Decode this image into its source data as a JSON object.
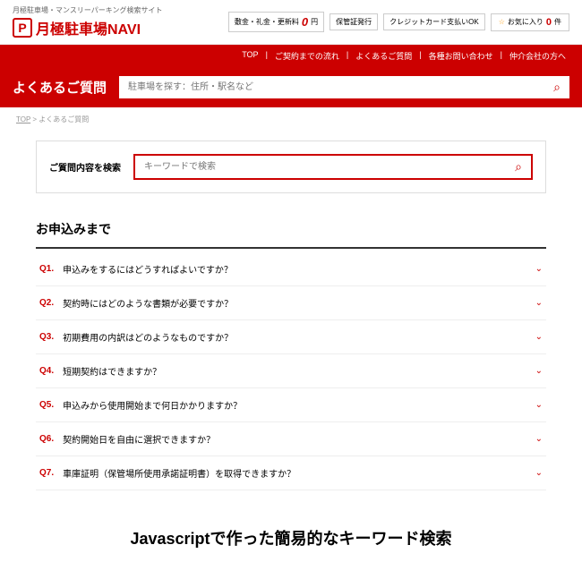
{
  "header": {
    "tagline": "月極駐車場・マンスリーパーキング検索サイト",
    "logo_text": "月極駐車場NAVI",
    "info1_pre": "敷金・礼金・更新料",
    "info1_zero": "0",
    "info1_yen": "円",
    "info2": "保管証発行",
    "info3": "クレジットカード支払いOK",
    "fav_label": "お気に入り",
    "fav_count": "0",
    "fav_unit": "件"
  },
  "nav": {
    "items": [
      "TOP",
      "ご契約までの流れ",
      "よくあるご質問",
      "各種お問い合わせ",
      "仲介会社の方へ"
    ]
  },
  "searchbar": {
    "title": "よくあるご質問",
    "placeholder": "駐車場を探す：住所・駅名など"
  },
  "breadcrumb": {
    "home": "TOP",
    "sep": " > ",
    "current": "よくあるご質問"
  },
  "faq_search": {
    "label": "ご質問内容を検索",
    "placeholder": "キーワードで検索"
  },
  "section": {
    "title": "お申込みまで"
  },
  "faqs": [
    {
      "q": "Q1.",
      "text": "申込みをするにはどうすればよいですか？"
    },
    {
      "q": "Q2.",
      "text": "契約時にはどのような書類が必要ですか？"
    },
    {
      "q": "Q3.",
      "text": "初期費用の内訳はどのようなものですか？"
    },
    {
      "q": "Q4.",
      "text": "短期契約はできますか？"
    },
    {
      "q": "Q5.",
      "text": "申込みから使用開始まで何日かかりますか？"
    },
    {
      "q": "Q6.",
      "text": "契約開始日を自由に選択できますか？"
    },
    {
      "q": "Q7.",
      "text": "車庫証明（保管場所使用承諾証明書）を取得できますか？"
    }
  ],
  "caption": "Javascriptで作った簡易的なキーワード検索"
}
